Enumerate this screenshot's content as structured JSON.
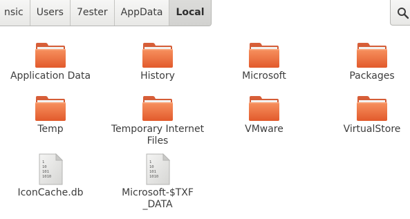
{
  "path_bar": {
    "crumbs": [
      "nsic",
      "Users",
      "7ester",
      "AppData",
      "Local"
    ]
  },
  "items": [
    {
      "label": "Application Data",
      "kind": "folder",
      "icon": "folder-icon"
    },
    {
      "label": "History",
      "kind": "folder",
      "icon": "folder-icon"
    },
    {
      "label": "Microsoft",
      "kind": "folder",
      "icon": "folder-icon"
    },
    {
      "label": "Packages",
      "kind": "folder",
      "icon": "folder-icon"
    },
    {
      "label": "Temp",
      "kind": "folder",
      "icon": "folder-icon"
    },
    {
      "label": "Temporary Internet Files",
      "kind": "folder",
      "icon": "folder-icon"
    },
    {
      "label": "VMware",
      "kind": "folder",
      "icon": "folder-icon"
    },
    {
      "label": "VirtualStore",
      "kind": "folder",
      "icon": "folder-icon"
    },
    {
      "label": "IconCache.db",
      "kind": "file",
      "icon": "binary-file-icon"
    },
    {
      "label": "Microsoft-$TXF_DATA",
      "kind": "file",
      "icon": "binary-file-icon"
    }
  ],
  "file_icon_text": [
    "1",
    "10",
    "101",
    "1010"
  ],
  "colors": {
    "folder_orange": "#e8693c",
    "folder_tab": "#c9542a",
    "active_crumb": "#d6d6d4"
  }
}
